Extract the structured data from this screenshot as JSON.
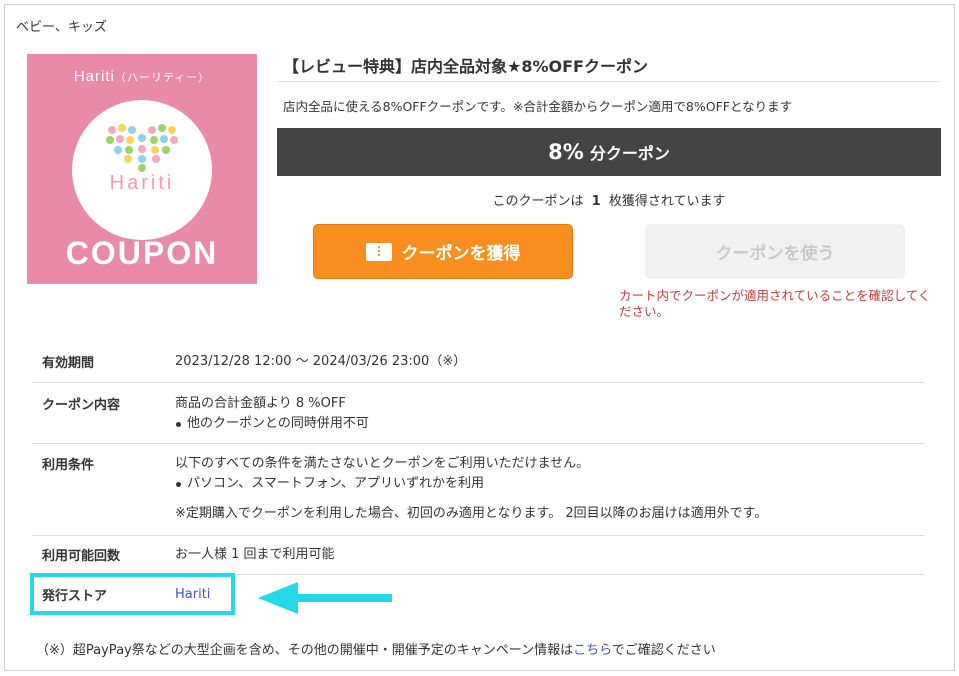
{
  "category": "ベビー、キッズ",
  "coupon_image": {
    "brand": "Hariti",
    "brand_kana": "（ハーリティー）",
    "center_text": "Hariti",
    "coupon_word": "COUPON"
  },
  "coupon": {
    "title": "【レビュー特典】店内全品対象★8%OFFクーポン",
    "description": "店内全品に使える8%OFFクーポンです。※合計金額からクーポン適用で8%OFFとなります",
    "discount_value": "8%",
    "discount_unit": "分クーポン",
    "acquired_prefix": "このクーポンは",
    "acquired_count": "1",
    "acquired_suffix": "枚獲得されています",
    "get_button_label": "クーポンを獲得",
    "use_button_label": "クーポンを使う",
    "cart_note": "カート内でクーポンが適用されていることを確認してください。"
  },
  "details": {
    "period_label": "有効期間",
    "period_value": "2023/12/28 12:00 ～ 2024/03/26 23:00（※）",
    "content_label": "クーポン内容",
    "content_value": "商品の合計金額より 8 %OFF",
    "content_bullet": "他のクーポンとの同時併用不可",
    "conditions_label": "利用条件",
    "conditions_value": "以下のすべての条件を満たさないとクーポンをご利用いただけません。",
    "conditions_bullet": "パソコン、スマートフォン、アプリいずれかを利用",
    "conditions_extra": "※定期購入でクーポンを利用した場合、初回のみ適用となります。 2回目以降のお届けは適用外です。",
    "count_label": "利用可能回数",
    "count_value": "お一人様 1 回まで利用可能",
    "store_label": "発行ストア",
    "store_value": "Hariti"
  },
  "footnote": {
    "prefix": "（※）超PayPay祭などの大型企画を含め、その他の開催中・開催予定のキャンペーン情報は",
    "link": "こちら",
    "suffix": "でご確認ください"
  },
  "colors": {
    "get_button": "#f98f1e",
    "highlight": "#25d8e8",
    "note_red": "#c03a3a",
    "bar": "#444444",
    "coupon_pink": "#e98aa9"
  }
}
